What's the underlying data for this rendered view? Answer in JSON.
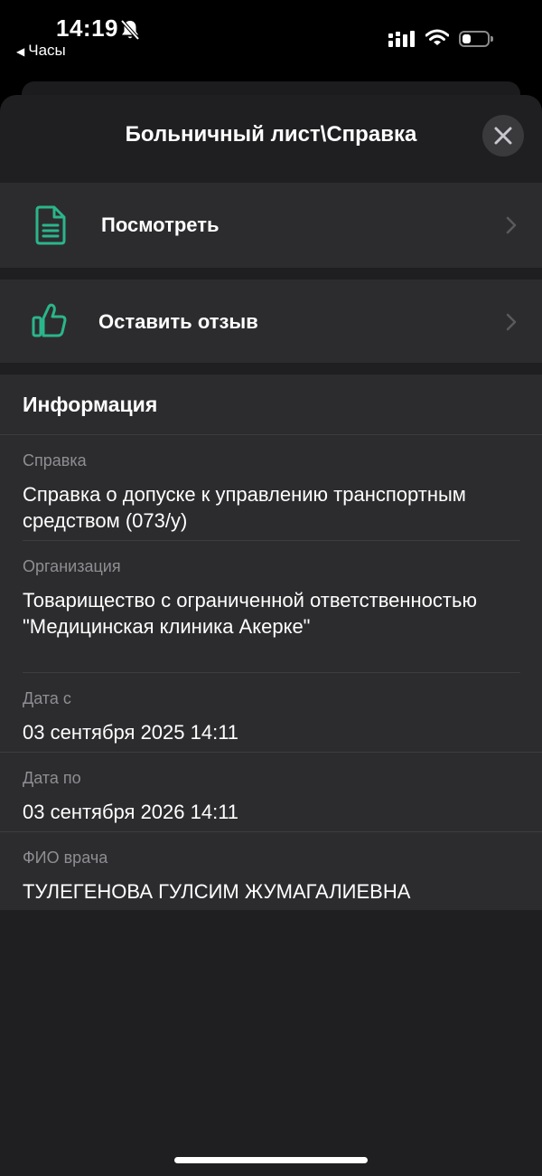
{
  "status_bar": {
    "time": "14:19",
    "back_app": "Часы",
    "battery_level": 0.35
  },
  "sheet": {
    "title": "Больничный лист\\Справка",
    "actions": [
      {
        "label": "Посмотреть",
        "icon": "document-icon"
      },
      {
        "label": "Оставить отзыв",
        "icon": "thumbs-up-icon"
      }
    ],
    "info": {
      "title": "Информация",
      "fields": [
        {
          "label": "Справка",
          "value": "Справка о допуске к управлению транспортным средством (073/у)"
        },
        {
          "label": "Организация",
          "value": "Товарищество с ограниченной ответственностью \"Медицинская клиника Акерке\""
        },
        {
          "label": "Дата с",
          "value": "03 сентября 2025 14:11"
        },
        {
          "label": "Дата по",
          "value": "03 сентября 2026 14:11"
        },
        {
          "label": "ФИО врача",
          "value": "ТУЛЕГЕНОВА ГУЛСИМ ЖУМАГАЛИЕВНА"
        }
      ]
    }
  },
  "colors": {
    "accent": "#2bb58a",
    "sheet_bg": "#1f1f21",
    "row_bg": "#2c2c2e",
    "label_gray": "#8e8e93"
  }
}
